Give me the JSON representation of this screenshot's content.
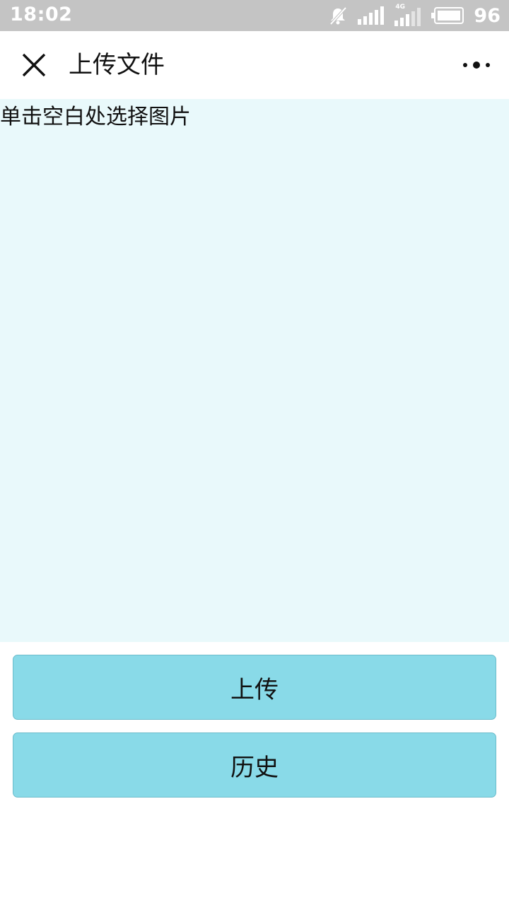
{
  "status_bar": {
    "time": "18:02",
    "battery": "96",
    "network_label": "4G",
    "icons": [
      "bell-muted-icon",
      "signal-icon",
      "signal-4g-icon",
      "battery-icon"
    ]
  },
  "navbar": {
    "title": "上传文件",
    "close_icon": "close-icon",
    "more_icon": "more-dots-icon"
  },
  "picker": {
    "hint": "单击空白处选择图片",
    "background": "#e9f9fb"
  },
  "buttons": {
    "upload_label": "上传",
    "history_label": "历史",
    "background": "#89dae8"
  }
}
